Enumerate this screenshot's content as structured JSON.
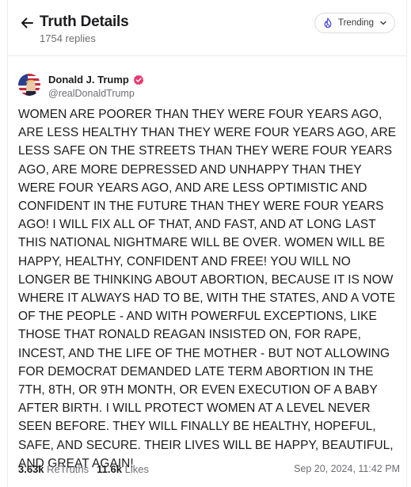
{
  "header": {
    "title": "Truth Details",
    "subtitle": "1754 replies",
    "trending_label": "Trending"
  },
  "post": {
    "author_name": "Donald J. Trump",
    "author_handle": "@realDonaldTrump",
    "body": "WOMEN ARE POORER THAN THEY WERE FOUR YEARS AGO, ARE LESS HEALTHY THAN THEY WERE FOUR YEARS AGO, ARE LESS SAFE ON THE STREETS THAN THEY WERE FOUR YEARS AGO, ARE MORE DEPRESSED AND UNHAPPY THAN THEY WERE FOUR YEARS AGO, AND ARE LESS OPTIMISTIC AND CONFIDENT IN THE FUTURE THAN THEY WERE FOUR YEARS AGO! I WILL FIX ALL OF THAT, AND FAST, AND AT LONG LAST THIS NATIONAL NIGHTMARE WILL BE OVER. WOMEN WILL BE HAPPY, HEALTHY, CONFIDENT AND FREE! YOU WILL NO LONGER BE THINKING ABOUT ABORTION, BECAUSE IT IS NOW WHERE IT ALWAYS HAD TO BE, WITH THE STATES, AND A VOTE OF THE PEOPLE - AND WITH POWERFUL EXCEPTIONS, LIKE THOSE THAT RONALD REAGAN INSISTED ON, FOR RAPE, INCEST, AND THE LIFE OF THE MOTHER - BUT NOT ALLOWING FOR DEMOCRAT DEMANDED LATE TERM ABORTION IN THE 7TH, 8TH, OR 9TH MONTH, OR EVEN EXECUTION OF A BABY AFTER BIRTH. I WILL PROTECT WOMEN AT A LEVEL NEVER SEEN BEFORE. THEY WILL FINALLY BE HEALTHY, HOPEFUL, SAFE, AND SECURE. THEIR LIVES WILL BE HAPPY, BEAUTIFUL, AND GREAT AGAIN!",
    "retruths_count": "3.63k",
    "retruths_label": "ReTruths",
    "likes_count": "11.6k",
    "likes_label": "Likes",
    "timestamp": "Sep 20, 2024, 11:42 PM"
  },
  "icons": {
    "back": "arrow-left-icon",
    "trending": "flame-icon",
    "dropdown": "chevron-down-icon",
    "verified": "verified-badge-icon"
  },
  "colors": {
    "verified": "#e8386e",
    "trending_icon": "#4b50e6",
    "text_primary": "#1c1c1e",
    "text_secondary": "#6e6e73"
  }
}
